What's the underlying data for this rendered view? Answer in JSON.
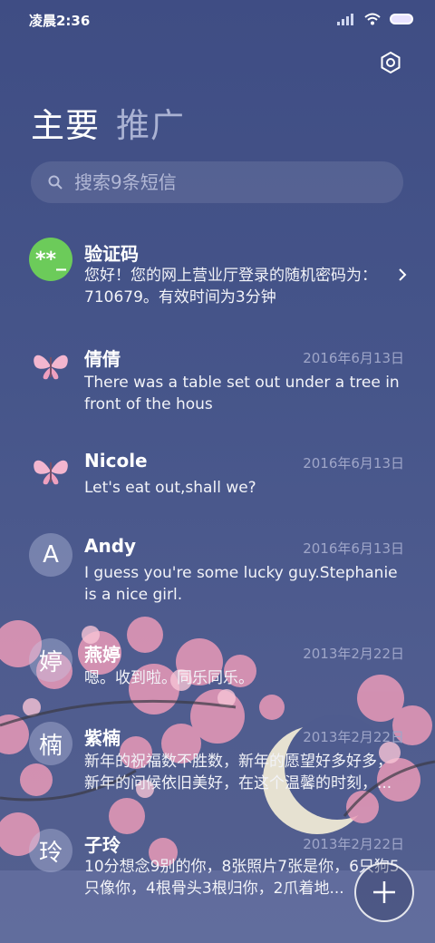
{
  "status": {
    "time": "凌晨2:36"
  },
  "tabs": {
    "main": "主要",
    "promotions": "推广"
  },
  "search": {
    "placeholder": "搜索9条短信"
  },
  "conversations": [
    {
      "name": "验证码",
      "avatar": "**_",
      "date": "",
      "message": "您好！您的网上营业厅登录的随机密码为：710679。有效时间为3分钟"
    },
    {
      "name": "倩倩",
      "avatar": "butterfly",
      "date": "2016年6月13日",
      "message": "There was a table set out under a tree in front of the hous"
    },
    {
      "name": "Nicole",
      "avatar": "butterfly",
      "date": "2016年6月13日",
      "message": "Let's eat out,shall we?"
    },
    {
      "name": "Andy",
      "avatar": "A",
      "date": "2016年6月13日",
      "message": "I guess you're some lucky guy.Stephanie is a nice girl."
    },
    {
      "name": "燕婷",
      "avatar": "婷",
      "date": "2013年2月22日",
      "message": "嗯。收到啦。同乐同乐。"
    },
    {
      "name": "紫楠",
      "avatar": "楠",
      "date": "2013年2月22日",
      "message": "新年的祝福数不胜数，新年的愿望好多好多，新年的问候依旧美好，在这个温馨的时刻，..."
    },
    {
      "name": "子玲",
      "avatar": "玲",
      "date": "2013年2月22日",
      "message": "10分想念9别的你，8张照片7张是你，6只狗5只像你，4根骨头3根归你，2爪着地..."
    }
  ],
  "colors": {
    "background": "#46558a",
    "verification_avatar": "#6ccb5a",
    "blossom": "#f0a9c2"
  },
  "icons": {
    "settings": "settings-icon",
    "search": "search-icon",
    "compose": "plus-icon",
    "chevron": "chevron-right-icon"
  }
}
